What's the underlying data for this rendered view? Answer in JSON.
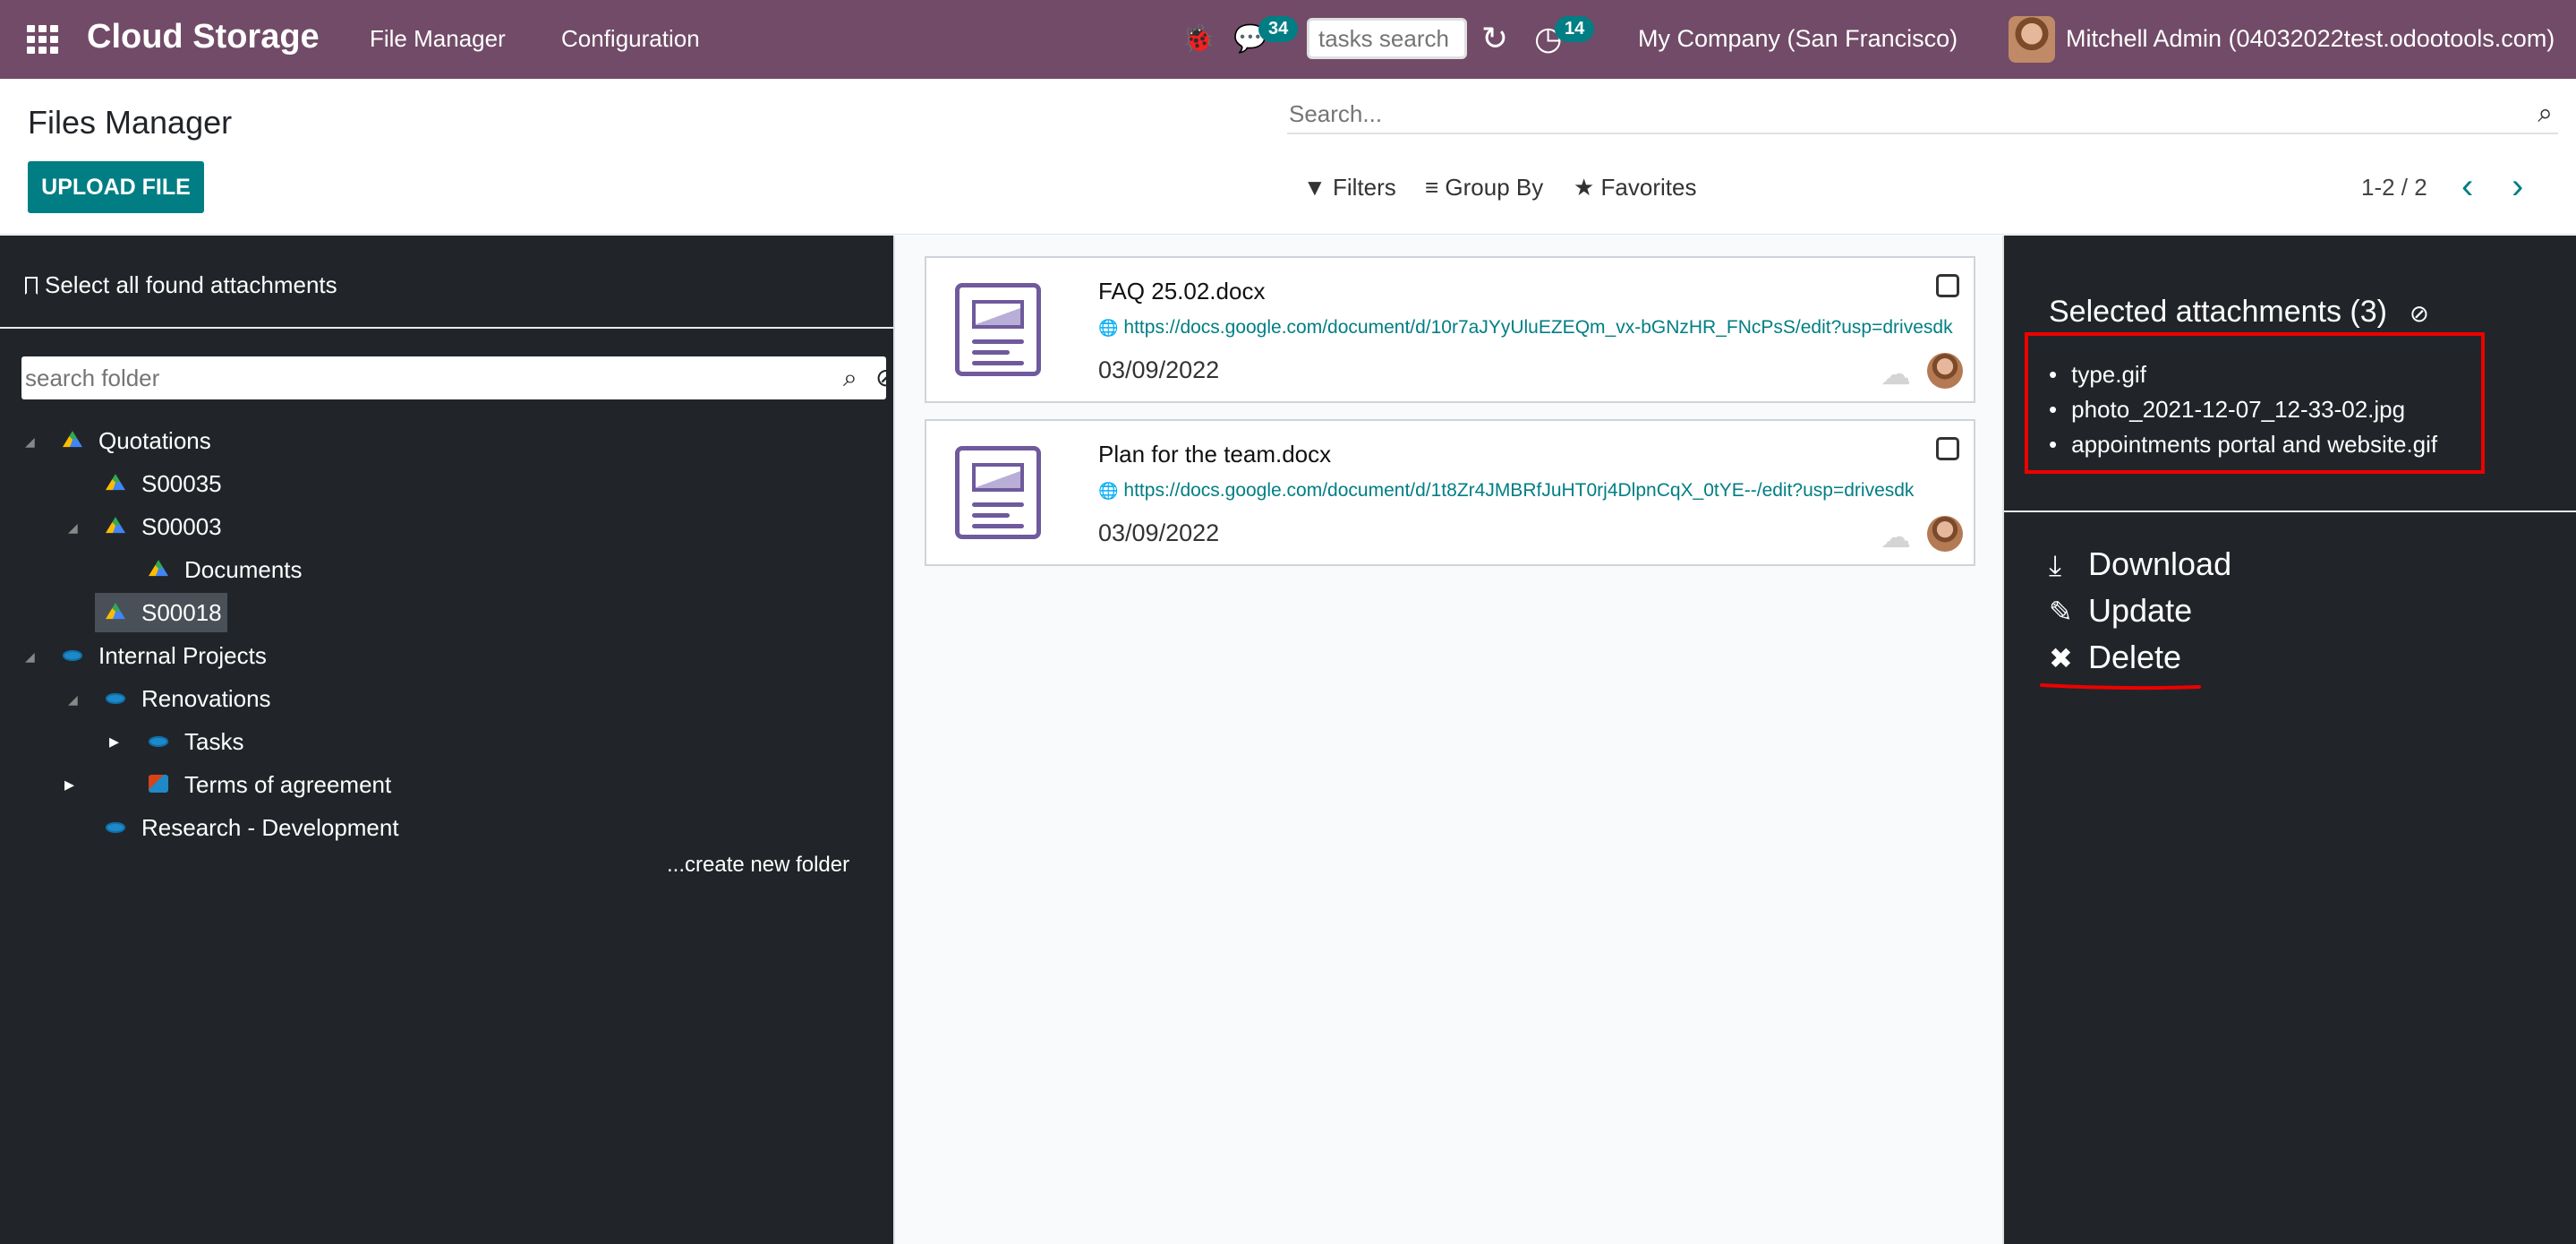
{
  "navbar": {
    "brand": "Cloud Storage",
    "menu": [
      "File Manager",
      "Configuration"
    ],
    "chat_count": "34",
    "activity_count": "14",
    "tasks_search_placeholder": "tasks search",
    "company": "My Company (San Francisco)",
    "user": "Mitchell Admin (04032022test.odootools.com)",
    "icons": [
      "apps-icon",
      "bug-icon",
      "chat-icon",
      "sync-icon",
      "activity-icon"
    ]
  },
  "control_panel": {
    "title": "Files Manager",
    "upload_label": "UPLOAD FILE",
    "search_placeholder": "Search...",
    "filters_label": "Filters",
    "groupby_label": "Group By",
    "favorites_label": "Favorites",
    "pager": "1-2 / 2"
  },
  "left_panel": {
    "select_all": "Select all found attachments",
    "folder_search_placeholder": "search folder",
    "tree": [
      {
        "label": "Quotations",
        "icon": "gdrive-icon"
      },
      {
        "label": "S00035",
        "icon": "gdrive-icon"
      },
      {
        "label": "S00003",
        "icon": "gdrive-icon"
      },
      {
        "label": "Documents",
        "icon": "gdrive-icon"
      },
      {
        "label": "S00018",
        "icon": "gdrive-icon",
        "selected": true
      },
      {
        "label": "Internal Projects",
        "icon": "sharepoint-icon"
      },
      {
        "label": "Renovations",
        "icon": "sharepoint-icon"
      },
      {
        "label": "Tasks",
        "icon": "sharepoint-icon"
      },
      {
        "label": "Terms of agreement",
        "icon": "document-icon"
      },
      {
        "label": "Research - Development",
        "icon": "sharepoint-icon"
      }
    ],
    "create_folder": "...create new folder"
  },
  "files": [
    {
      "name": "FAQ 25.02.docx",
      "url": "https://docs.google.com/document/d/10r7aJYyUluEZEQm_vx-bGNzHR_FNcPsS/edit?usp=drivesdk",
      "date": "03/09/2022"
    },
    {
      "name": "Plan for the team.docx",
      "url": "https://docs.google.com/document/d/1t8Zr4JMBRfJuHT0rj4DlpnCqX_0tYE--/edit?usp=drivesdk",
      "date": "03/09/2022"
    }
  ],
  "right_panel": {
    "title": "Selected attachments (3)",
    "selected": [
      "type.gif",
      "photo_2021-12-07_12-33-02.jpg",
      "appointments portal and website.gif"
    ],
    "actions": {
      "download": "Download",
      "update": "Update",
      "delete": "Delete"
    }
  },
  "colors": {
    "navbar": "#714b67",
    "accent": "#017e84",
    "dark_panel": "#212529",
    "highlight": "#e00000"
  }
}
